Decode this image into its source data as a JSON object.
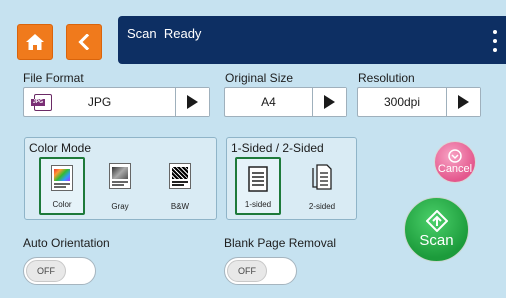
{
  "header": {
    "status_text": "Scan  Ready"
  },
  "file_format": {
    "label": "File Format",
    "value": "JPG",
    "icon_tag": "JPG"
  },
  "original_size": {
    "label": "Original Size",
    "value": "A4"
  },
  "resolution": {
    "label": "Resolution",
    "value": "300dpi"
  },
  "color_mode": {
    "title": "Color Mode",
    "options": [
      {
        "label": "Color",
        "selected": true
      },
      {
        "label": "Gray",
        "selected": false
      },
      {
        "label": "B&W",
        "selected": false
      }
    ]
  },
  "sides": {
    "title": "1-Sided / 2-Sided",
    "options": [
      {
        "label": "1-sided",
        "selected": true
      },
      {
        "label": "2-sided",
        "selected": false
      }
    ]
  },
  "cancel_label": "Cancel",
  "scan_label": "Scan",
  "auto_orientation": {
    "label": "Auto Orientation",
    "state": "OFF"
  },
  "blank_page_removal": {
    "label": "Blank Page Removal",
    "state": "OFF"
  },
  "colors": {
    "background": "#c6e2f0",
    "header": "#0d2f63",
    "orange_button": "#f07a1c",
    "scan_green": "#1c9b3b",
    "cancel_pink": "#e4578d",
    "selected_outline": "#1e7a3a"
  },
  "icons": [
    "home-icon",
    "back-arrow-icon",
    "more-vert-icon",
    "jpg-file-icon",
    "play-arrow-icon",
    "cancel-icon",
    "scan-icon"
  ]
}
